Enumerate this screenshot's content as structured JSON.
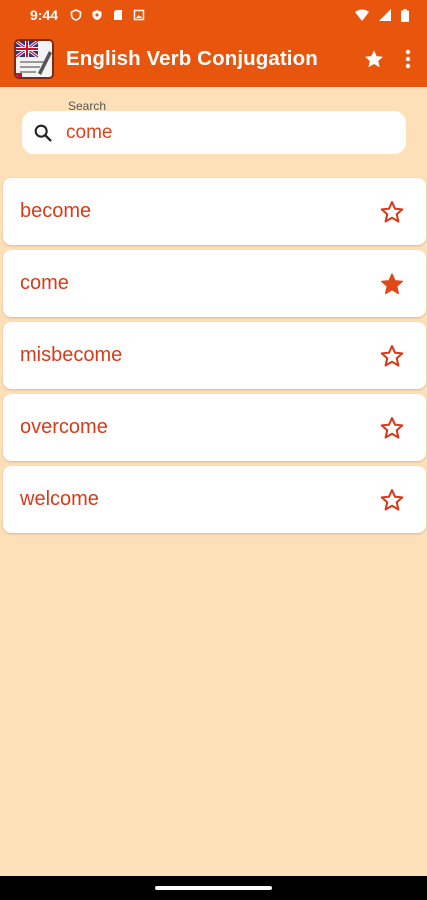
{
  "status_bar": {
    "time": "9:44",
    "icons_left": [
      "shield-icon",
      "vpn-shield-icon",
      "sd-card-icon",
      "image-icon"
    ],
    "icons_right": [
      "wifi-icon",
      "signal-icon",
      "battery-icon"
    ]
  },
  "app_bar": {
    "title": "English Verb Conjugation",
    "actions": [
      "favorites-star-icon",
      "more-vert-icon"
    ]
  },
  "search": {
    "label": "Search",
    "value": "come",
    "icon": "search-icon"
  },
  "verbs": [
    {
      "label": "become",
      "favorite": false
    },
    {
      "label": "come",
      "favorite": true
    },
    {
      "label": "misbecome",
      "favorite": false
    },
    {
      "label": "overcome",
      "favorite": false
    },
    {
      "label": "welcome",
      "favorite": false
    }
  ],
  "colors": {
    "primary": "#e8560e",
    "background": "#fee0b8",
    "text_accent": "#d93a1a"
  }
}
